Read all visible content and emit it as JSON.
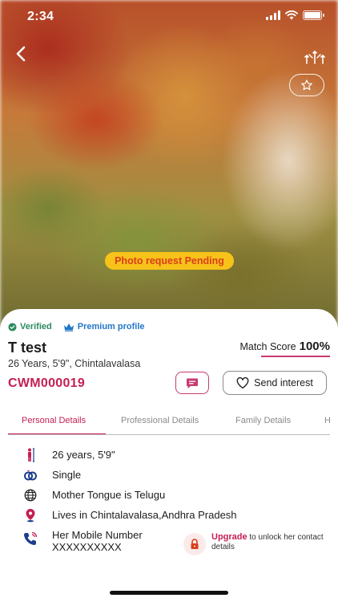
{
  "status_bar": {
    "time": "2:34"
  },
  "hero": {
    "photo_request_label": "Photo request Pending"
  },
  "badges": {
    "verified": "Verified",
    "premium": "Premium profile"
  },
  "profile": {
    "name": "T test",
    "summary": "26 Years, 5'9\", Chintalavalasa",
    "id": "CWM000019"
  },
  "match": {
    "label": "Match Score",
    "value": "100%"
  },
  "actions": {
    "send_interest": "Send interest"
  },
  "tabs": [
    {
      "label": "Personal Details",
      "active": true
    },
    {
      "label": "Professional Details",
      "active": false
    },
    {
      "label": "Family Details",
      "active": false
    },
    {
      "label": "H",
      "active": false
    }
  ],
  "details": [
    {
      "icon": "height-icon",
      "text": "26 years, 5'9\""
    },
    {
      "icon": "rings-icon",
      "text": "Single"
    },
    {
      "icon": "globe-icon",
      "text": "Mother Tongue is Telugu"
    },
    {
      "icon": "location-pin-icon",
      "text": "Lives in Chintalavalasa,Andhra Pradesh"
    }
  ],
  "mobile": {
    "label": "Her Mobile Number",
    "value": "XXXXXXXXXX",
    "upgrade": "Upgrade",
    "upgrade_suffix": " to unlock her contact details"
  },
  "colors": {
    "brand": "#c41f52",
    "pending_bg": "#f7c21a",
    "verified": "#2d8a5f",
    "premium": "#2277c7"
  }
}
